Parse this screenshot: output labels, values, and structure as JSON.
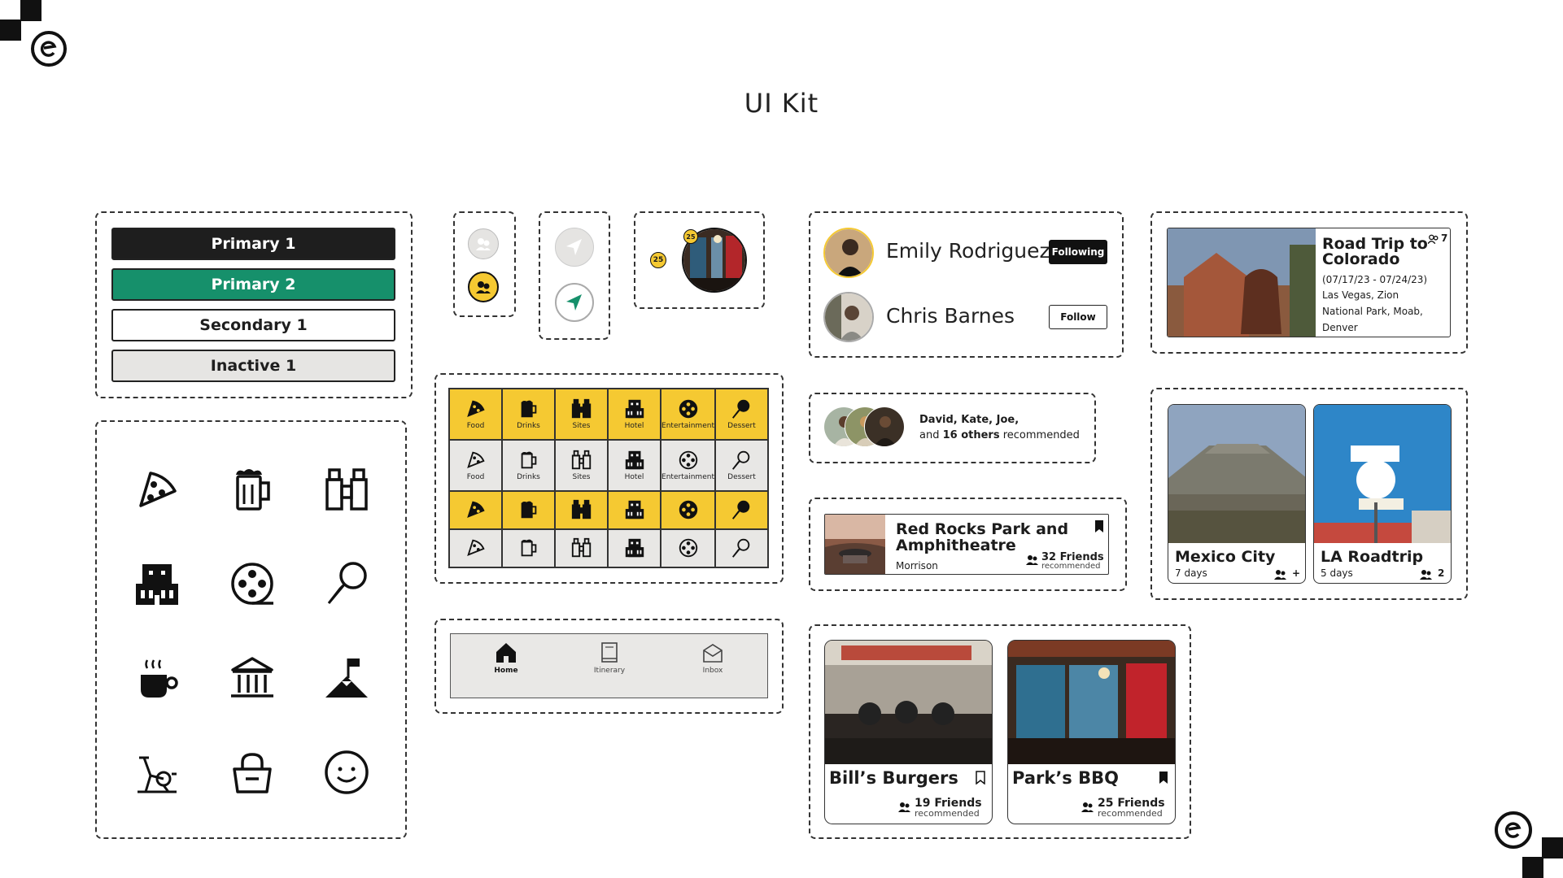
{
  "page": {
    "title": "UI Kit"
  },
  "buttons": {
    "primary1": "Primary 1",
    "primary2": "Primary 2",
    "secondary1": "Secondary 1",
    "inactive1": "Inactive 1"
  },
  "icons": [
    "pizza-icon",
    "beer-mug-icon",
    "binoculars-icon",
    "hotel-icon",
    "film-reel-icon",
    "ice-cream-icon",
    "coffee-cup-icon",
    "museum-icon",
    "mountain-flag-icon",
    "exercise-bike-icon",
    "shopping-bag-icon",
    "smiley-icon"
  ],
  "map_markers": {
    "badge_count": "25",
    "photo_badge_count": "25"
  },
  "categories": {
    "labels": [
      "Food",
      "Drinks",
      "Sites",
      "Hotel",
      "Entertainment",
      "Dessert"
    ]
  },
  "navbar": {
    "items": [
      {
        "label": "Home",
        "icon": "home-icon",
        "active": true
      },
      {
        "label": "Itinerary",
        "icon": "book-icon",
        "active": false
      },
      {
        "label": "Inbox",
        "icon": "inbox-icon",
        "active": false
      }
    ]
  },
  "people": [
    {
      "name": "Emily Rodriguez",
      "button": "Following"
    },
    {
      "name": "Chris Barnes",
      "button": "Follow"
    }
  ],
  "recommend": {
    "line1": "David, Kate, Joe,",
    "line2_prefix": "and ",
    "line2_count": "16 others",
    "line2_suffix": " recommended"
  },
  "place_card": {
    "title": "Red Rocks Park and Amphitheatre",
    "location": "Morrison",
    "friends": "32 Friends",
    "recommended": "recommended"
  },
  "restaurants": [
    {
      "name": "Bill’s Burgers",
      "friends": "19 Friends",
      "recommended": "recommended",
      "saved": false
    },
    {
      "name": "Park’s BBQ",
      "friends": "25 Friends",
      "recommended": "recommended",
      "saved": true
    }
  ],
  "trip": {
    "title_line1": "Road Trip to",
    "title_line2": "Colorado",
    "count": "7",
    "dates": "(07/17/23 - 07/24/23)",
    "route_line1": "Las Vegas, Zion",
    "route_line2": "National Park, Moab,",
    "route_line3": "Denver"
  },
  "trip_tiles": [
    {
      "name": "Mexico City",
      "days": "7 days",
      "count": "+"
    },
    {
      "name": "LA Roadtrip",
      "days": "5 days",
      "count": "2"
    }
  ],
  "colors": {
    "yellow": "#f5c932",
    "green": "#16906b",
    "dark": "#1e1e1e",
    "gray": "#e6e5e3"
  }
}
